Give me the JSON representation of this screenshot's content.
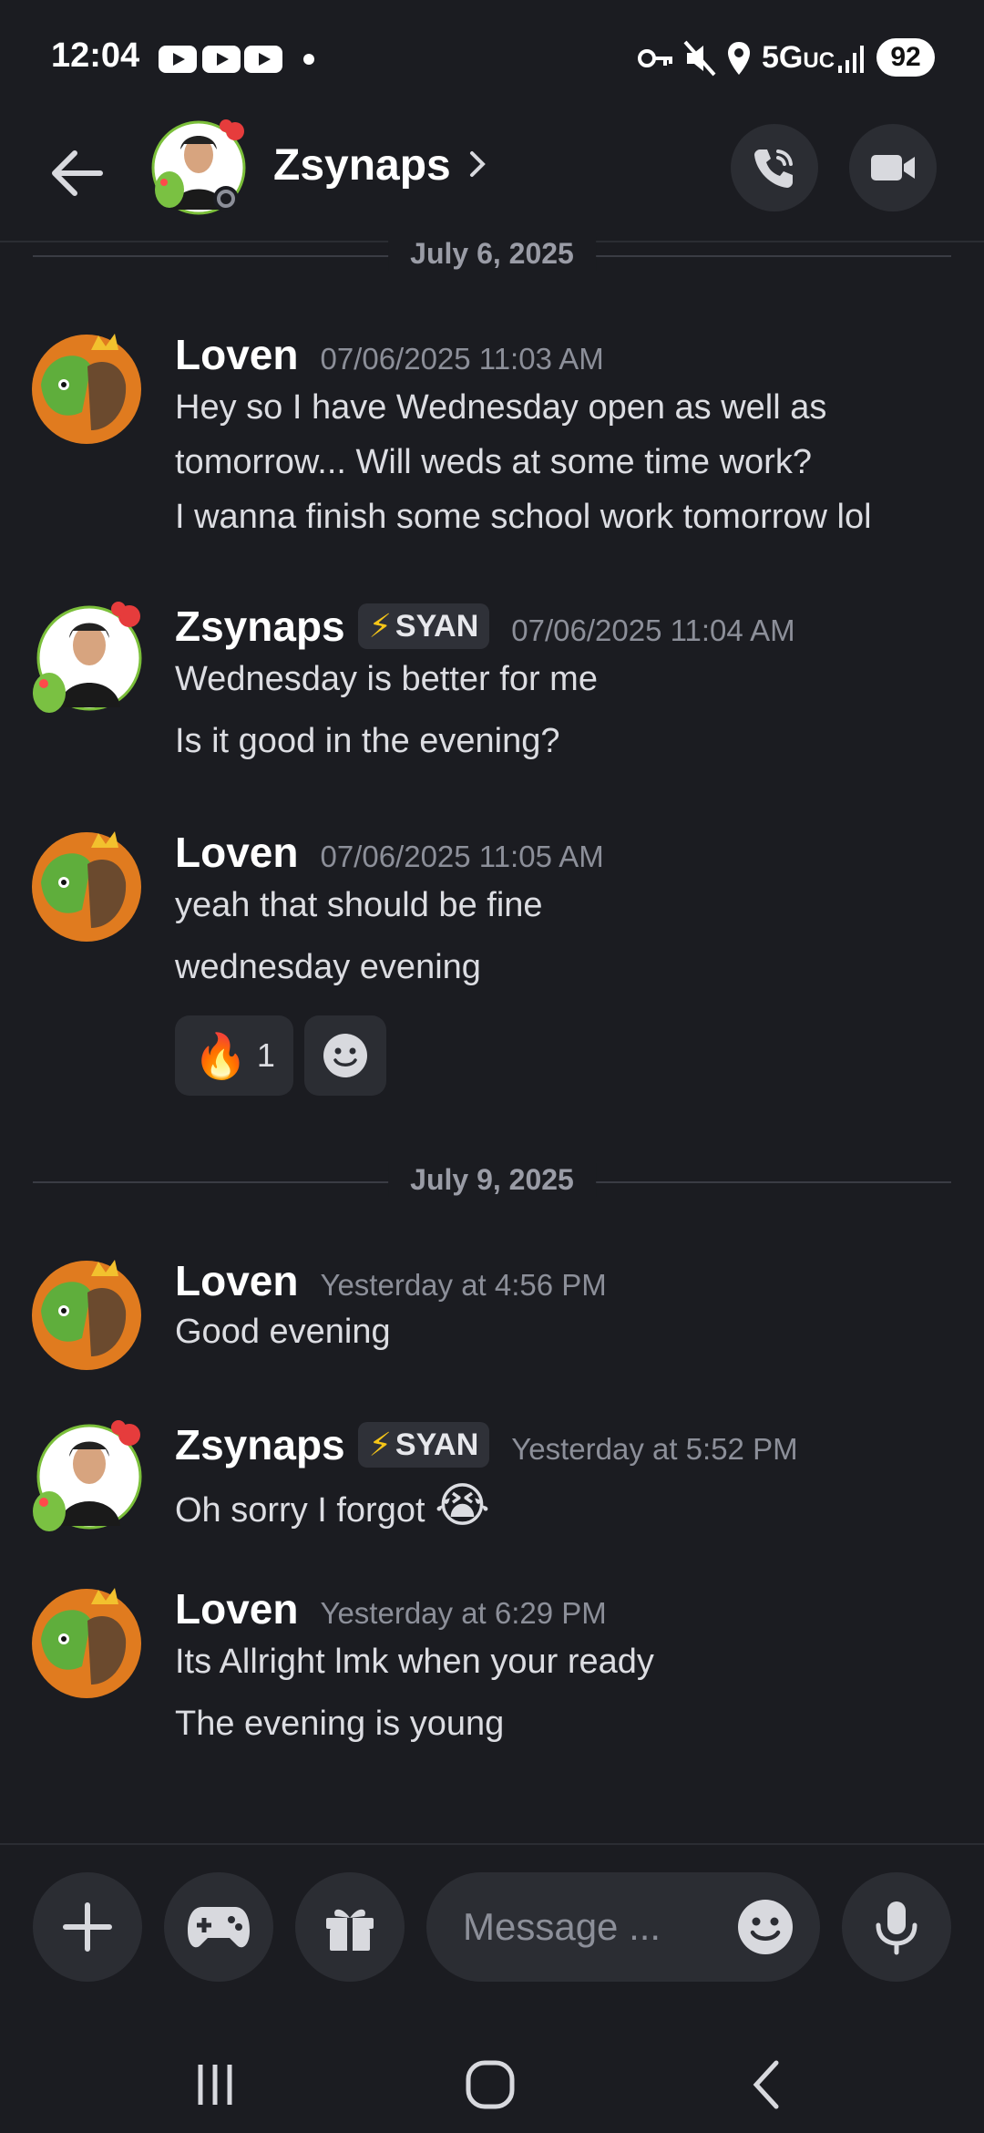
{
  "status_bar": {
    "time": "12:04",
    "network": "5G",
    "network_suffix": "UC",
    "battery": "92",
    "icons": [
      "youtube-icon",
      "youtube-icon",
      "youtube-icon",
      "dot-icon",
      "key-icon",
      "mute-icon",
      "location-icon",
      "signal-icon"
    ]
  },
  "header": {
    "title": "Zsynaps",
    "icons": [
      "back-arrow-icon",
      "chevron-right-icon",
      "phone-call-icon",
      "video-camera-icon"
    ]
  },
  "dates": [
    "July 6, 2025",
    "July 9, 2025"
  ],
  "messages": [
    {
      "author": "Loven",
      "timestamp": "07/06/2025 11:03 AM",
      "lines": [
        "Hey so I have Wednesday open as well as",
        "tomorrow... Will weds at some time  work?",
        "I wanna finish some school work tomorrow lol"
      ]
    },
    {
      "author": "Zsynaps",
      "tag": "SYAN",
      "timestamp": "07/06/2025 11:04 AM",
      "lines": [
        "Wednesday is better for me",
        "Is it good in the evening?"
      ]
    },
    {
      "author": "Loven",
      "timestamp": "07/06/2025 11:05 AM",
      "lines": [
        "yeah that should be fine",
        "wednesday evening"
      ],
      "reactions": [
        {
          "emoji": "🔥",
          "count": "1"
        }
      ]
    },
    {
      "author": "Loven",
      "timestamp": "Yesterday at 4:56 PM",
      "lines": [
        "Good evening"
      ]
    },
    {
      "author": "Zsynaps",
      "tag": "SYAN",
      "timestamp": "Yesterday at 5:52 PM",
      "lines": [
        "Oh sorry I forgot"
      ],
      "emoji": "😭"
    },
    {
      "author": "Loven",
      "timestamp": "Yesterday at 6:29 PM",
      "lines": [
        "Its Allright lmk when your ready",
        "The evening is young"
      ]
    }
  ],
  "composer": {
    "placeholder": "Message ...",
    "icons": [
      "plus-icon",
      "gamepad-icon",
      "gift-icon",
      "emoji-icon",
      "microphone-icon"
    ]
  },
  "colors": {
    "background": "#1b1c21",
    "surface": "#2b2d33",
    "text": "#dcdde2",
    "muted": "#8c8f99",
    "bolt": "#f5c518"
  }
}
